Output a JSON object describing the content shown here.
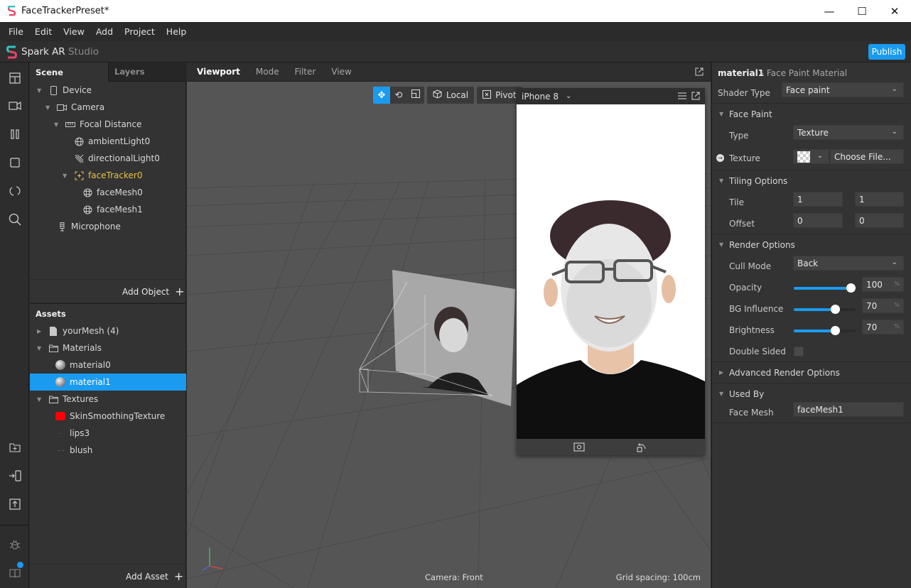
{
  "window": {
    "title": "FaceTrackerPreset*",
    "controls": {
      "minimize": "—",
      "maximize": "☐",
      "close": "✕"
    }
  },
  "menu": [
    "File",
    "Edit",
    "View",
    "Add",
    "Project",
    "Help"
  ],
  "brand": {
    "name": "Spark AR",
    "suffix": " Studio",
    "publish_label": "Publish"
  },
  "colors": {
    "accent": "#1a9bf0",
    "tracker": "#e8c34a",
    "skin_texture": "#ff0000"
  },
  "rail": {
    "icons": [
      "layout-icon",
      "camera-icon",
      "pause-icon",
      "square-icon",
      "sync-icon",
      "search-icon",
      "add-folder-icon",
      "send-to-device-icon",
      "upload-icon",
      "bug-icon",
      "docs-icon"
    ]
  },
  "scene": {
    "tabs": [
      "Scene",
      "Layers"
    ],
    "items": [
      {
        "label": "Device",
        "icon": "device-icon",
        "expanded": true
      },
      {
        "label": "Camera",
        "icon": "camera-icon",
        "expanded": true
      },
      {
        "label": "Focal Distance",
        "icon": "ruler-icon",
        "expanded": true
      },
      {
        "label": "ambientLight0",
        "icon": "globe-icon"
      },
      {
        "label": "directionalLight0",
        "icon": "directional-light-icon"
      },
      {
        "label": "faceTracker0",
        "icon": "face-tracker-icon",
        "expanded": true,
        "highlighted": true
      },
      {
        "label": "faceMesh0",
        "icon": "mesh-icon"
      },
      {
        "label": "faceMesh1",
        "icon": "mesh-icon"
      },
      {
        "label": "Microphone",
        "icon": "microphone-icon"
      }
    ],
    "add_object_label": "Add Object"
  },
  "assets": {
    "title": "Assets",
    "items": [
      {
        "label": "yourMesh (4)",
        "icon": "file-icon",
        "collapsed": true
      },
      {
        "label": "Materials",
        "icon": "folder-icon",
        "expanded": true
      },
      {
        "label": "material0",
        "icon": "material-sphere-icon"
      },
      {
        "label": "material1",
        "icon": "material-sphere-icon",
        "selected": true
      },
      {
        "label": "Textures",
        "icon": "folder-icon",
        "expanded": true
      },
      {
        "label": "SkinSmoothingTexture",
        "icon": "red-texture-icon"
      },
      {
        "label": "lips3",
        "icon": "texture-icon"
      },
      {
        "label": "blush",
        "icon": "texture-icon"
      }
    ],
    "add_asset_label": "Add Asset"
  },
  "viewport": {
    "tabs": [
      "Viewport",
      "Mode",
      "Filter",
      "View"
    ],
    "toolbar": {
      "local_label": "Local",
      "pivot_label": "Pivot"
    },
    "camera_status": "Camera: Front",
    "grid_status": "Grid spacing: 100cm",
    "simulator": {
      "device": "iPhone 8"
    }
  },
  "properties": {
    "object_name": "material1",
    "object_type": "– Face Paint Material",
    "shader_type": {
      "label": "Shader Type",
      "value": "Face paint"
    },
    "face_paint": {
      "title": "Face Paint",
      "type": {
        "label": "Type",
        "value": "Texture"
      },
      "texture": {
        "label": "Texture",
        "value": "Choose File..."
      }
    },
    "tiling": {
      "title": "Tiling Options",
      "tile": {
        "label": "Tile",
        "x": "1",
        "y": "1"
      },
      "offset": {
        "label": "Offset",
        "x": "0",
        "y": "0"
      }
    },
    "render": {
      "title": "Render Options",
      "cull_mode": {
        "label": "Cull Mode",
        "value": "Back"
      },
      "opacity": {
        "label": "Opacity",
        "value": "100",
        "unit": "%",
        "fraction": 1.0
      },
      "bg_influence": {
        "label": "BG Influence",
        "value": "70",
        "unit": "%",
        "fraction": 0.7
      },
      "brightness": {
        "label": "Brightness",
        "value": "70",
        "unit": "%",
        "fraction": 0.7
      },
      "double_sided": {
        "label": "Double Sided",
        "checked": false
      }
    },
    "advanced": {
      "title": "Advanced Render Options"
    },
    "used_by": {
      "title": "Used By",
      "face_mesh": {
        "label": "Face Mesh",
        "value": "faceMesh1"
      }
    }
  }
}
